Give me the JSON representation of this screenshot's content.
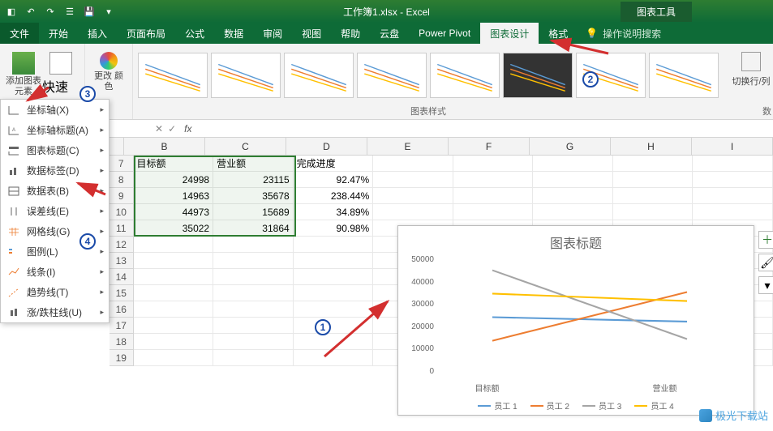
{
  "app": {
    "title": "工作簿1.xlsx - Excel",
    "context_tab": "图表工具"
  },
  "tabs": {
    "file": "文件",
    "home": "开始",
    "insert": "插入",
    "page_layout": "页面布局",
    "formulas": "公式",
    "data": "数据",
    "review": "审阅",
    "view": "视图",
    "help": "帮助",
    "cloud": "云盘",
    "power_pivot": "Power Pivot",
    "chart_design": "图表设计",
    "format": "格式",
    "tell_me": "操作说明搜索"
  },
  "ribbon": {
    "add_element": "添加图表\n元素",
    "quick_layout": "快速布局",
    "change_colors": "更改\n颜色",
    "chart_styles": "图表样式",
    "switch_rc": "切换行/列",
    "data_group": "数"
  },
  "menu": {
    "axes": "坐标轴(X)",
    "axis_titles": "坐标轴标题(A)",
    "chart_title": "图表标题(C)",
    "data_labels": "数据标签(D)",
    "data_table": "数据表(B)",
    "error_bars": "误差线(E)",
    "gridlines": "网格线(G)",
    "legend": "图例(L)",
    "lines": "线条(I)",
    "trendline": "趋势线(T)",
    "up_down_bars": "涨/跌柱线(U)"
  },
  "formula_bar": {
    "fx": "fx"
  },
  "columns": [
    "B",
    "C",
    "D",
    "E",
    "F",
    "G",
    "H",
    "I"
  ],
  "sheet": {
    "headers": {
      "b": "目标额",
      "c": "营业额",
      "d": "完成进度"
    },
    "rows": [
      {
        "n": "8",
        "b": "24998",
        "c": "23115",
        "d": "92.47%"
      },
      {
        "n": "9",
        "b": "14963",
        "c": "35678",
        "d": "238.44%"
      },
      {
        "n": "10",
        "b": "44973",
        "c": "15689",
        "d": "34.89%"
      },
      {
        "n": "11",
        "b": "35022",
        "c": "31864",
        "d": "90.98%"
      }
    ],
    "empty_rows": [
      "12",
      "13",
      "14",
      "15",
      "16",
      "17",
      "18",
      "19"
    ]
  },
  "chart": {
    "title": "图表标题",
    "ylabels": [
      "50000",
      "40000",
      "30000",
      "20000",
      "10000",
      "0"
    ],
    "categories": [
      "目标额",
      "营业额"
    ],
    "legend": [
      "员工 1",
      "员工 2",
      "员工 3",
      "员工 4"
    ]
  },
  "chart_data": {
    "type": "line",
    "title": "图表标题",
    "categories": [
      "目标额",
      "营业额"
    ],
    "ylim": [
      0,
      50000
    ],
    "series": [
      {
        "name": "员工 1",
        "values": [
          24998,
          23115
        ],
        "color": "#5b9bd5"
      },
      {
        "name": "员工 2",
        "values": [
          14963,
          35678
        ],
        "color": "#ed7d31"
      },
      {
        "name": "员工 3",
        "values": [
          44973,
          15689
        ],
        "color": "#a5a5a5"
      },
      {
        "name": "员工 4",
        "values": [
          35022,
          31864
        ],
        "color": "#ffc000"
      }
    ]
  },
  "watermark": "极光下载站"
}
